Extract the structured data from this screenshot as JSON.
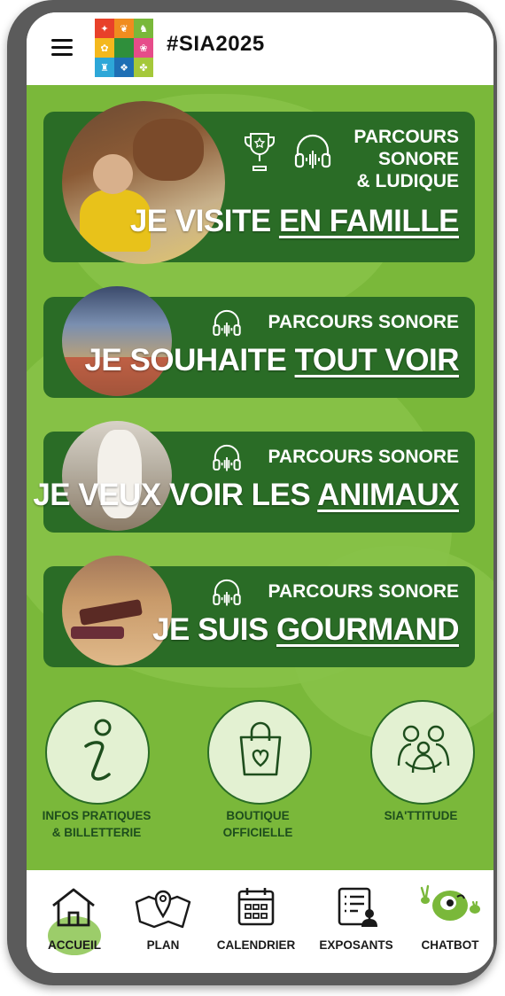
{
  "header": {
    "hashtag": "#SIA2025",
    "logo_colors": [
      "#e8412a",
      "#f08c1f",
      "#79b83a",
      "#f4b81d",
      "#2f8f3b",
      "#e64c8a",
      "#2da7d8",
      "#1e6fb5",
      "#a5c83a"
    ]
  },
  "cards": [
    {
      "label_lines": [
        "PARCOURS",
        "SONORE",
        "& LUDIQUE"
      ],
      "title_plain": "JE VISITE ",
      "title_underline": "EN FAMILLE"
    },
    {
      "label": "PARCOURS SONORE",
      "title_plain": "JE SOUHAITE ",
      "title_underline": "TOUT VOIR"
    },
    {
      "label": "PARCOURS SONORE",
      "title_plain": "JE VEUX VOIR LES ",
      "title_underline": "ANIMAUX"
    },
    {
      "label": "PARCOURS SONORE",
      "title_plain": "JE SUIS ",
      "title_underline": "GOURMAND"
    }
  ],
  "shortcuts": {
    "infos_line1": "INFOS PRATIQUES",
    "infos_line2": "& BILLETTERIE",
    "boutique_line1": "BOUTIQUE",
    "boutique_line2": "OFFICIELLE",
    "siattitude": "SIA'TTITUDE"
  },
  "nav": {
    "accueil": "ACCUEIL",
    "plan": "PLAN",
    "calendrier": "CALENDRIER",
    "exposants": "EXPOSANTS",
    "chatbot": "CHATBOT"
  },
  "colors": {
    "accent_green": "#2a6c26",
    "background_green": "#7ab83a",
    "light_green": "#e3f1d2"
  }
}
